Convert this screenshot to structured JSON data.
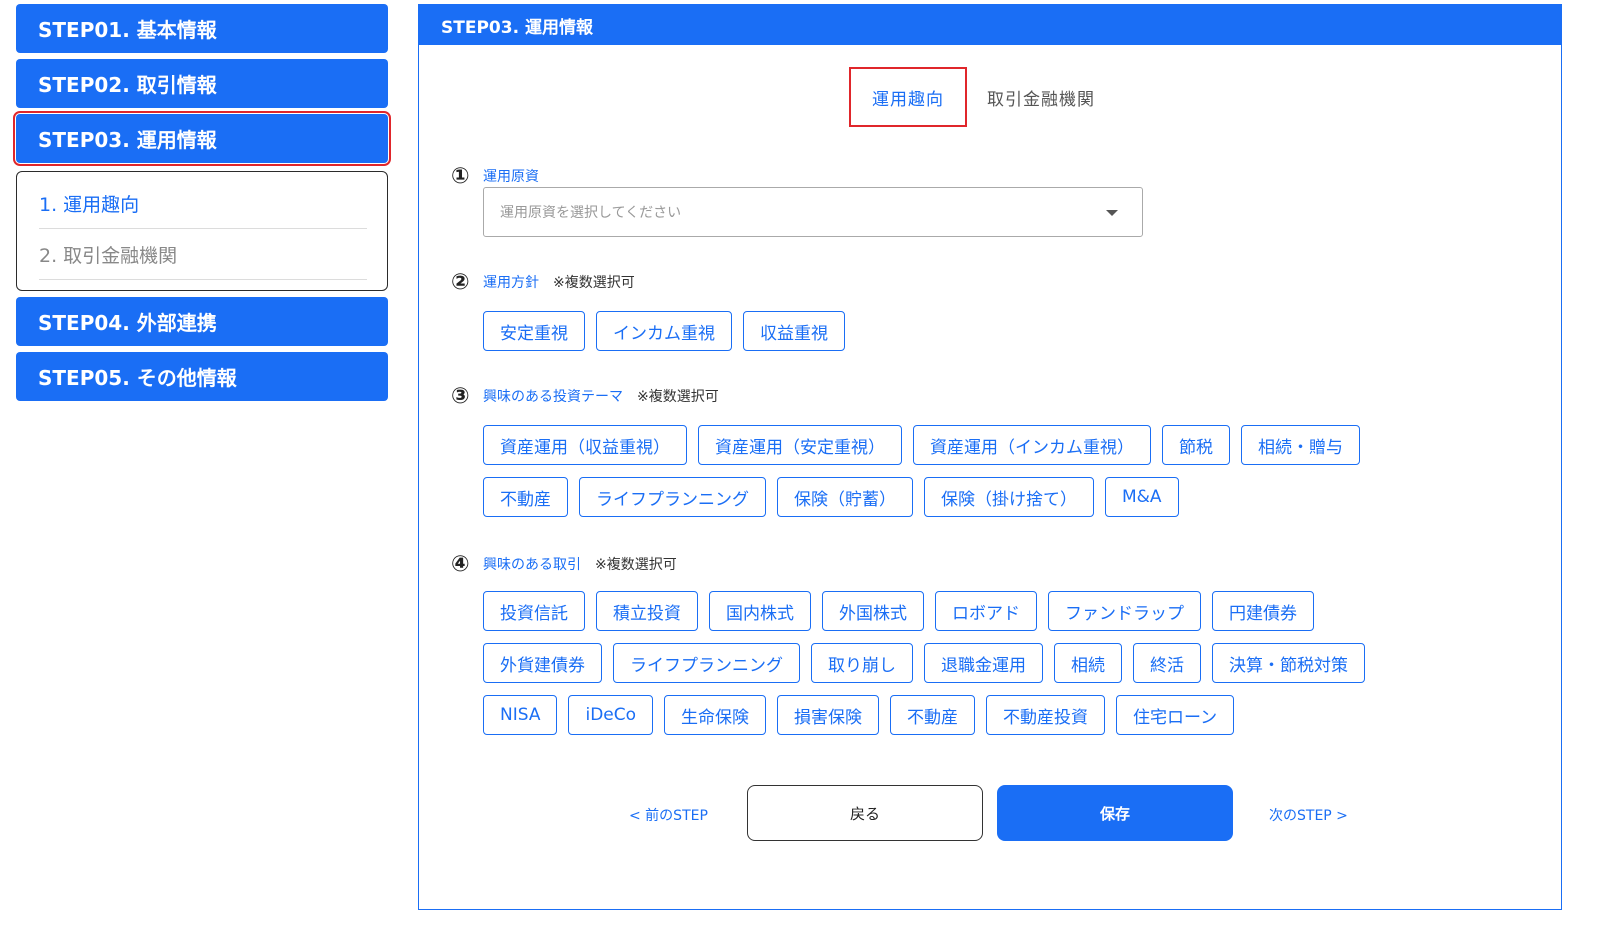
{
  "sidebar": {
    "steps": [
      {
        "label": "STEP01. 基本情報"
      },
      {
        "label": "STEP02. 取引情報"
      },
      {
        "label": "STEP03. 運用情報"
      },
      {
        "label": "STEP04. 外部連携"
      },
      {
        "label": "STEP05. その他情報"
      }
    ],
    "sub_items": [
      {
        "label": "1. 運用趣向"
      },
      {
        "label": "2. 取引金融機関"
      }
    ]
  },
  "main": {
    "header": "STEP03. 運用情報",
    "tabs": [
      "運用趣向",
      "取引金融機関"
    ],
    "q1": {
      "num": "①",
      "label": "運用原資",
      "placeholder": "運用原資を選択してください"
    },
    "q2": {
      "num": "②",
      "label": "運用方針",
      "note": "※複数選択可",
      "options": [
        "安定重視",
        "インカム重視",
        "収益重視"
      ]
    },
    "q3": {
      "num": "③",
      "label": "興味のある投資テーマ",
      "note": "※複数選択可",
      "row1": [
        "資産運用（収益重視）",
        "資産運用（安定重視）",
        "資産運用（インカム重視）",
        "節税",
        "相続・贈与"
      ],
      "row2": [
        "不動産",
        "ライフプランニング",
        "保険（貯蓄）",
        "保険（掛け捨て）",
        "M&A"
      ]
    },
    "q4": {
      "num": "④",
      "label": "興味のある取引",
      "note": "※複数選択可",
      "row1": [
        "投資信託",
        "積立投資",
        "国内株式",
        "外国株式",
        "ロボアド",
        "ファンドラップ",
        "円建債券"
      ],
      "row2": [
        "外貨建債券",
        "ライフプランニング",
        "取り崩し",
        "退職金運用",
        "相続",
        "終活",
        "決算・節税対策"
      ],
      "row3": [
        "NISA",
        "iDeCo",
        "生命保険",
        "損害保険",
        "不動産",
        "不動産投資",
        "住宅ローン"
      ]
    },
    "footer": {
      "prev": "< 前のSTEP",
      "back": "戻る",
      "save": "保存",
      "next": "次のSTEP >"
    }
  }
}
